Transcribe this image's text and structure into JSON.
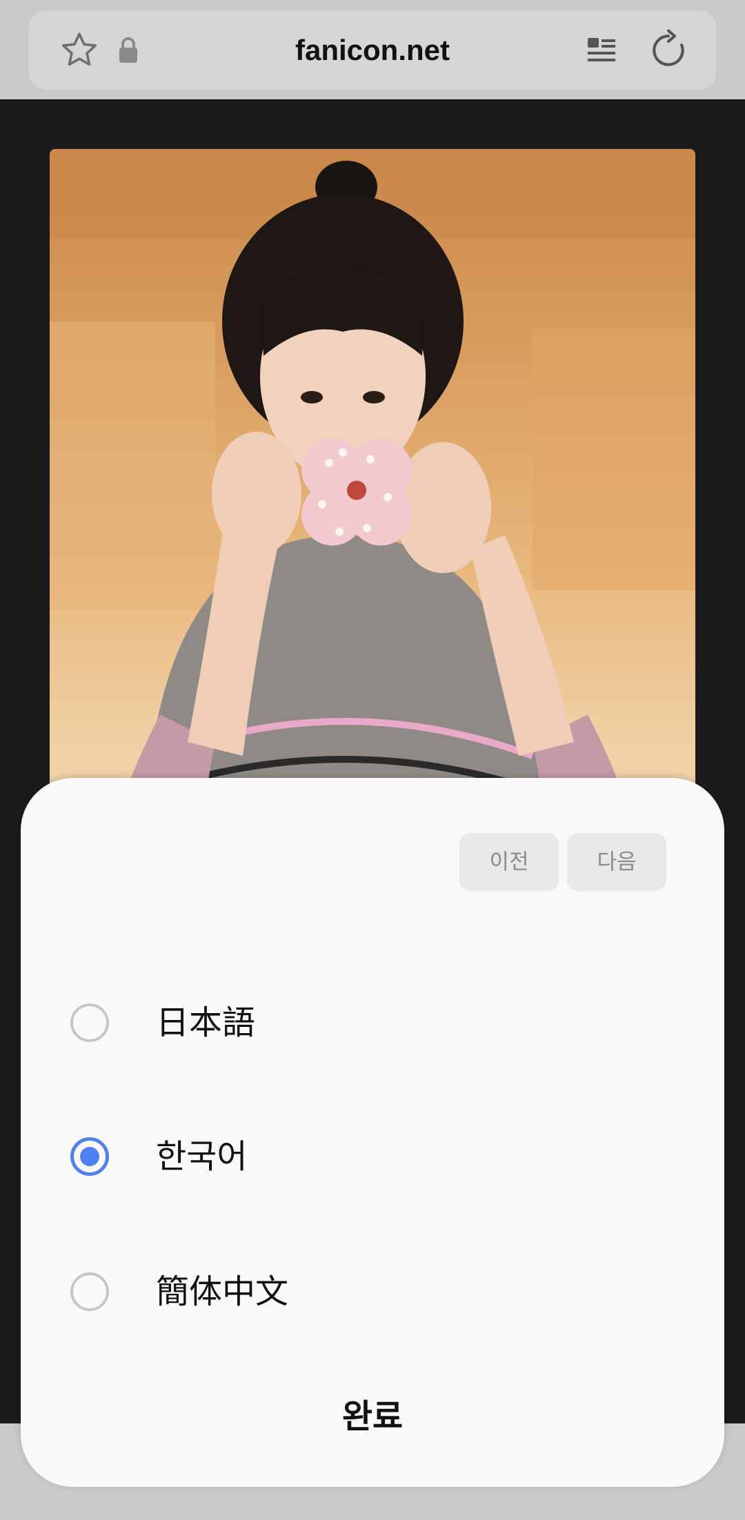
{
  "browser": {
    "url": "fanicon.net",
    "icons": [
      "star-icon",
      "lock-icon",
      "reader-mode-icon",
      "reload-icon"
    ]
  },
  "content": {
    "photo_description_icon": "photo"
  },
  "language_sheet": {
    "prev_label": "이전",
    "next_label": "다음",
    "options": [
      {
        "label": "日本語",
        "selected": false
      },
      {
        "label": "한국어",
        "selected": true
      },
      {
        "label": "簡体中文",
        "selected": false
      }
    ],
    "done_label": "완료"
  },
  "colors": {
    "accent": "#4f7ff0",
    "sheet_bg": "#f9f9f9",
    "page_bg": "#1b1b1d",
    "toolbar_bg": "#c9c9c9"
  }
}
